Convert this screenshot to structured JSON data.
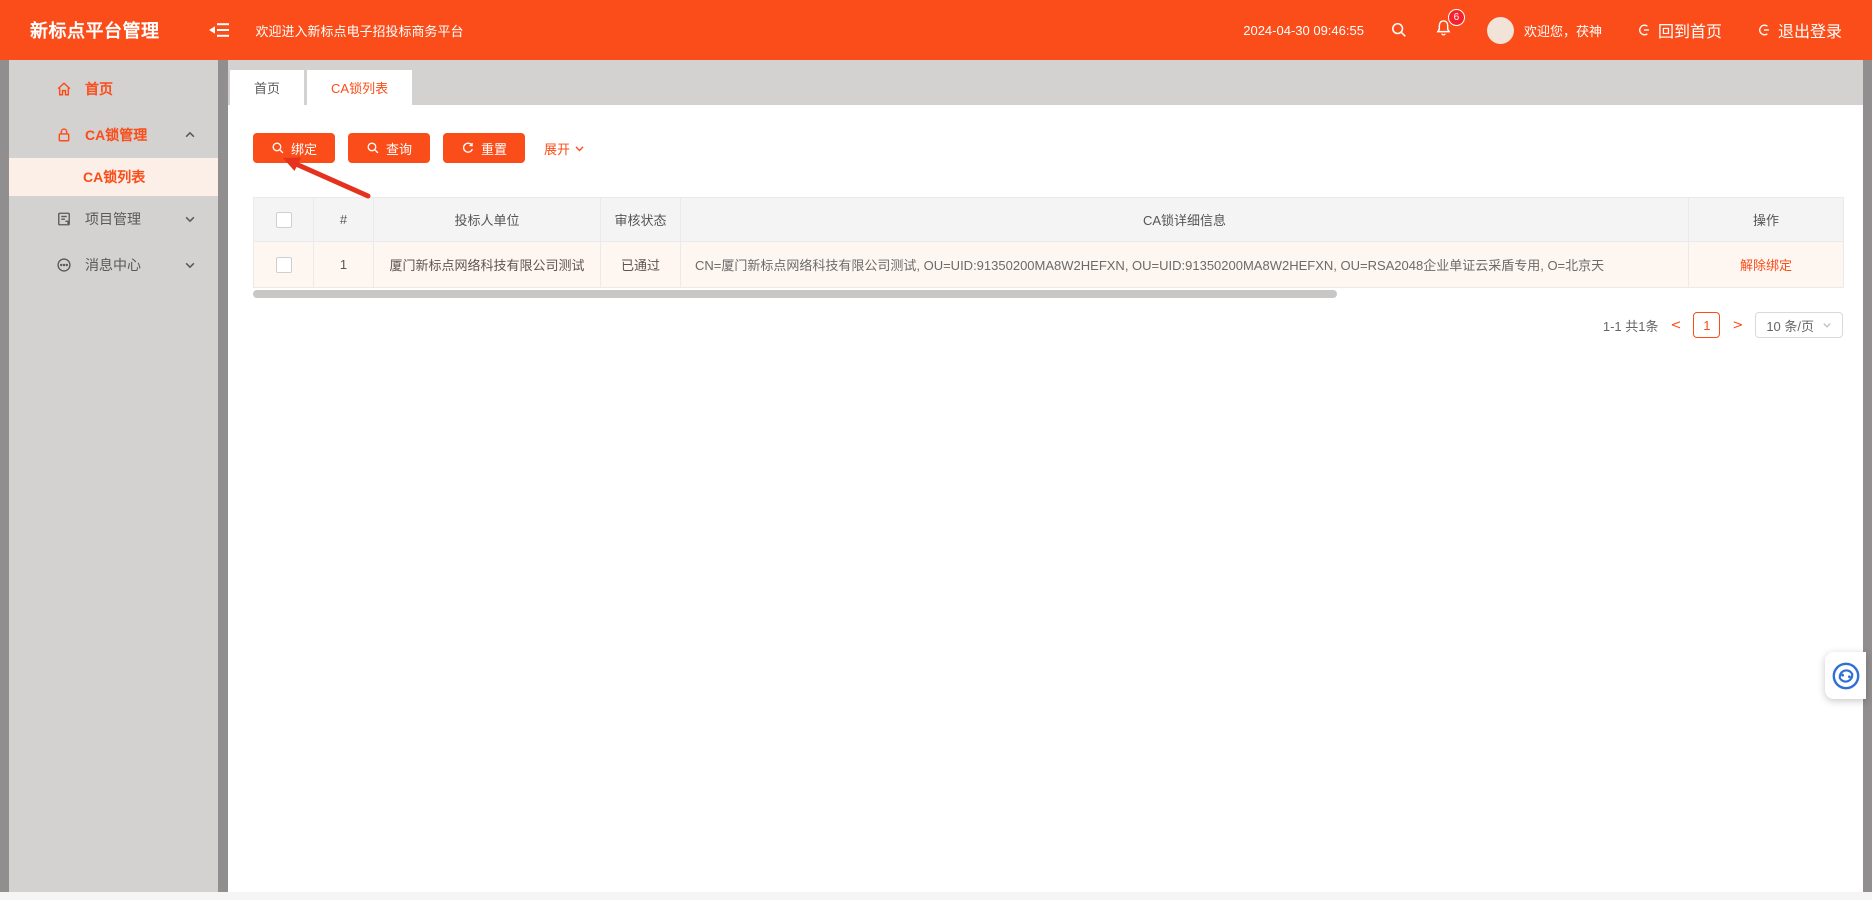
{
  "header": {
    "logo": "新标点平台管理",
    "welcome": "欢迎进入新标点电子招投标商务平台",
    "datetime": "2024-04-30 09:46:55",
    "notification_count": "6",
    "greeting": "欢迎您，茯神",
    "back_home": "回到首页",
    "logout": "退出登录"
  },
  "sidebar": {
    "items": [
      {
        "label": "首页"
      },
      {
        "label": "CA锁管理"
      },
      {
        "label": "CA锁列表"
      },
      {
        "label": "项目管理"
      },
      {
        "label": "消息中心"
      }
    ]
  },
  "tabs": {
    "home": "首页",
    "ca_list": "CA锁列表"
  },
  "toolbar": {
    "bind": "绑定",
    "query": "查询",
    "reset": "重置",
    "expand": "展开"
  },
  "table": {
    "headers": {
      "index": "#",
      "bidder": "投标人单位",
      "status": "审核状态",
      "detail": "CA锁详细信息",
      "action": "操作"
    },
    "rows": [
      {
        "index": "1",
        "bidder": "厦门新标点网络科技有限公司测试",
        "status": "已通过",
        "detail": "CN=厦门新标点网络科技有限公司测试, OU=UID:91350200MA8W2HEFXN, OU=UID:91350200MA8W2HEFXN, OU=RSA2048企业单证云采盾专用, O=北京天",
        "action": "解除绑定"
      }
    ]
  },
  "pagination": {
    "summary": "1-1 共1条",
    "prev": "<",
    "page": "1",
    "next": ">",
    "page_size": "10 条/页"
  },
  "colors": {
    "accent": "#fa4d19",
    "badge_red": "#f5222d",
    "sidebar_bg": "#d4d1d1",
    "selected_item_bg": "#fcefe8",
    "service_blue": "#2f6fd6"
  }
}
